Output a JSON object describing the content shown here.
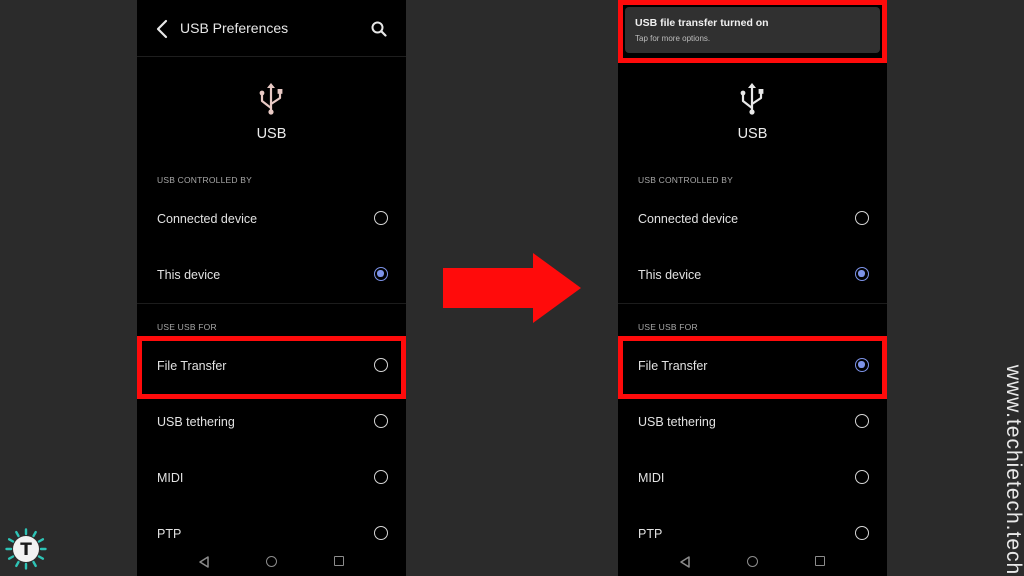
{
  "left_screen": {
    "header": {
      "title": "USB Preferences"
    },
    "usb_label": "USB",
    "controlled_by": {
      "title": "USB CONTROLLED BY",
      "options": [
        {
          "label": "Connected device",
          "selected": false
        },
        {
          "label": "This device",
          "selected": true
        }
      ]
    },
    "use_usb_for": {
      "title": "USE USB FOR",
      "options": [
        {
          "label": "File Transfer",
          "selected": false
        },
        {
          "label": "USB tethering",
          "selected": false
        },
        {
          "label": "MIDI",
          "selected": false
        },
        {
          "label": "PTP",
          "selected": false
        }
      ]
    }
  },
  "right_screen": {
    "notification": {
      "title": "USB file transfer turned on",
      "subtitle": "Tap for more options."
    },
    "usb_label": "USB",
    "controlled_by": {
      "title": "USB CONTROLLED BY",
      "options": [
        {
          "label": "Connected device",
          "selected": false
        },
        {
          "label": "This device",
          "selected": true
        }
      ]
    },
    "use_usb_for": {
      "title": "USE USB FOR",
      "options": [
        {
          "label": "File Transfer",
          "selected": true
        },
        {
          "label": "USB tethering",
          "selected": false
        },
        {
          "label": "MIDI",
          "selected": false
        },
        {
          "label": "PTP",
          "selected": false
        }
      ]
    }
  },
  "colors": {
    "background": "#2b2b2b",
    "screen": "#000000",
    "highlight": "#ff0b0b",
    "accent": "#7d93e8",
    "arrow": "#ff0b0b"
  },
  "watermark": "www.techietech.tech",
  "logo": {
    "letter": "T",
    "icon": "techietech-logo-icon"
  }
}
